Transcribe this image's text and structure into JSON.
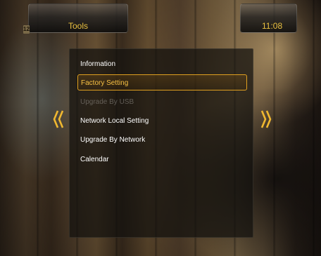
{
  "header": {
    "title": "Tools",
    "channel_badge": "12",
    "clock": "11:08"
  },
  "menu": {
    "items": [
      {
        "label": "Information",
        "state": "normal"
      },
      {
        "label": "Factory Setting",
        "state": "selected"
      },
      {
        "label": "Upgrade By USB",
        "state": "disabled"
      },
      {
        "label": "Network Local Setting",
        "state": "normal"
      },
      {
        "label": "Upgrade By Network",
        "state": "normal"
      },
      {
        "label": "Calendar",
        "state": "normal"
      }
    ]
  },
  "icons": {
    "left": "double-chevron-left-icon",
    "right": "double-chevron-right-icon"
  },
  "colors": {
    "accent": "#e9c040",
    "selection_border": "#e0a020",
    "text": "#ffffff",
    "disabled_text": "#8f8a86"
  }
}
